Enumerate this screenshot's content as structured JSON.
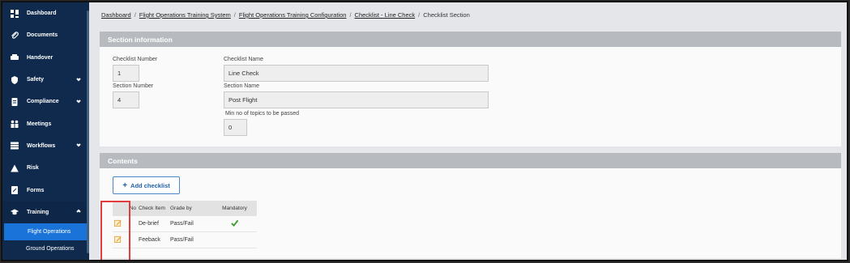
{
  "sidebar": {
    "items": [
      {
        "label": "Dashboard",
        "icon": "dashboard-icon"
      },
      {
        "label": "Documents",
        "icon": "paperclip-icon"
      },
      {
        "label": "Handover",
        "icon": "handover-icon"
      },
      {
        "label": "Safety",
        "icon": "shield-icon",
        "chevron": "down"
      },
      {
        "label": "Compliance",
        "icon": "compliance-icon",
        "chevron": "down"
      },
      {
        "label": "Meetings",
        "icon": "meetings-icon"
      },
      {
        "label": "Workflows",
        "icon": "workflows-icon",
        "chevron": "down"
      },
      {
        "label": "Risk",
        "icon": "risk-icon"
      },
      {
        "label": "Forms",
        "icon": "forms-icon"
      },
      {
        "label": "Training",
        "icon": "graduation-cap-icon",
        "chevron": "up"
      }
    ],
    "subitems": [
      {
        "label": "Flight Operations",
        "active": true
      },
      {
        "label": "Ground Operations",
        "active": false
      }
    ]
  },
  "breadcrumb": {
    "items": [
      "Dashboard",
      "Flight Operations Training System",
      "Flight Operations Training Configuration",
      "Checklist - Line Check"
    ],
    "current": "Checklist Section",
    "separator": "/"
  },
  "section_info": {
    "title": "Section information",
    "checklist_number_label": "Checklist Number",
    "checklist_number": "1",
    "checklist_name_label": "Checklist Name",
    "checklist_name": "Line Check",
    "section_number_label": "Section Number",
    "section_number": "4",
    "section_name_label": "Section Name",
    "section_name": "Post Flight",
    "min_topics_label": "Min no of topics to be passed",
    "min_topics": "0"
  },
  "contents": {
    "title": "Contents",
    "add_button": "Add checklist",
    "columns": [
      "No",
      "Check Item",
      "Grade by",
      "Mandatory"
    ],
    "rows": [
      {
        "item": "De-brief",
        "grade": "Pass/Fail",
        "mandatory": true
      },
      {
        "item": "Feeback",
        "grade": "Pass/Fail",
        "mandatory": false
      }
    ]
  },
  "colors": {
    "sidebar_bg": "#0f2a4d",
    "active_item": "#1a73d9",
    "panel_header": "#b7bbbf",
    "highlight": "#e23c3c",
    "check": "#3a9a2a",
    "edit_icon": "#e8a33d"
  }
}
